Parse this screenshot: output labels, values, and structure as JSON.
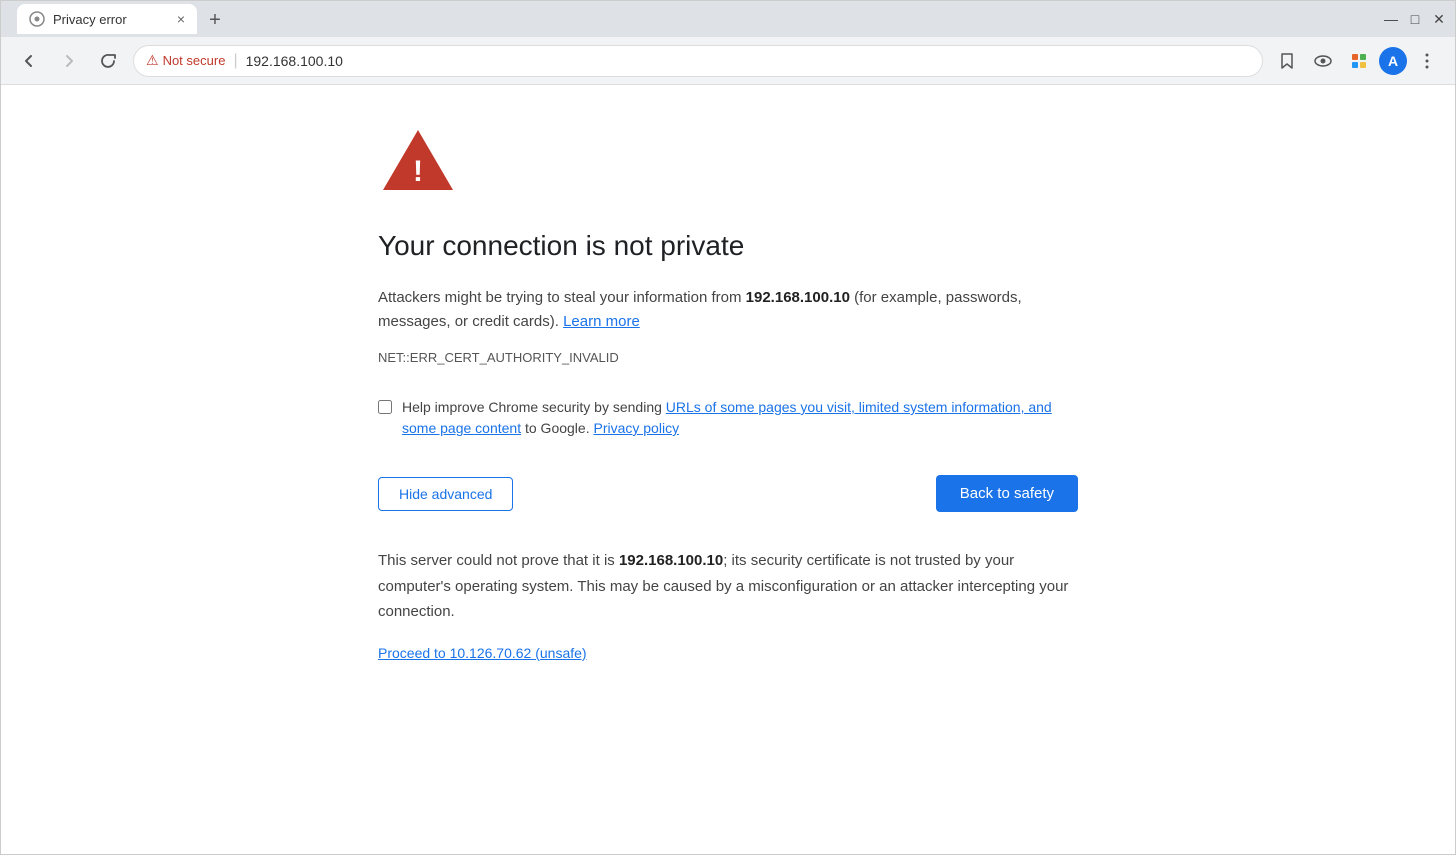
{
  "browser": {
    "title_bar": {
      "tab_title": "Privacy error",
      "tab_close_label": "×",
      "new_tab_label": "+",
      "minimize": "—",
      "maximize": "□",
      "close": "✕"
    },
    "nav_bar": {
      "back_tooltip": "Back",
      "forward_tooltip": "Forward",
      "refresh_tooltip": "Reload",
      "not_secure_label": "Not secure",
      "url": "192.168.100.10",
      "bookmark_tooltip": "Bookmark",
      "profile_letter": "A"
    }
  },
  "page": {
    "error_code": "NET::ERR_CERT_AUTHORITY_INVALID",
    "title": "Your connection is not private",
    "description_pre": "Attackers might be trying to steal your information from ",
    "description_domain": "192.168.100.10",
    "description_post": " (for example, passwords, messages, or credit cards).",
    "learn_more": "Learn more",
    "checkbox_pre": "Help improve Chrome security by sending ",
    "checkbox_link": "URLs of some pages you visit, limited system information, and some page content",
    "checkbox_post": " to Google.",
    "privacy_policy_link": "Privacy policy",
    "hide_advanced_label": "Hide advanced",
    "back_to_safety_label": "Back to safety",
    "advanced_pre": "This server could not prove that it is ",
    "advanced_domain": "192.168.100.10",
    "advanced_post": "; its security certificate is not trusted by your computer's operating system. This may be caused by a misconfiguration or an attacker intercepting your connection.",
    "proceed_link": "Proceed to 10.126.70.62 (unsafe)"
  }
}
